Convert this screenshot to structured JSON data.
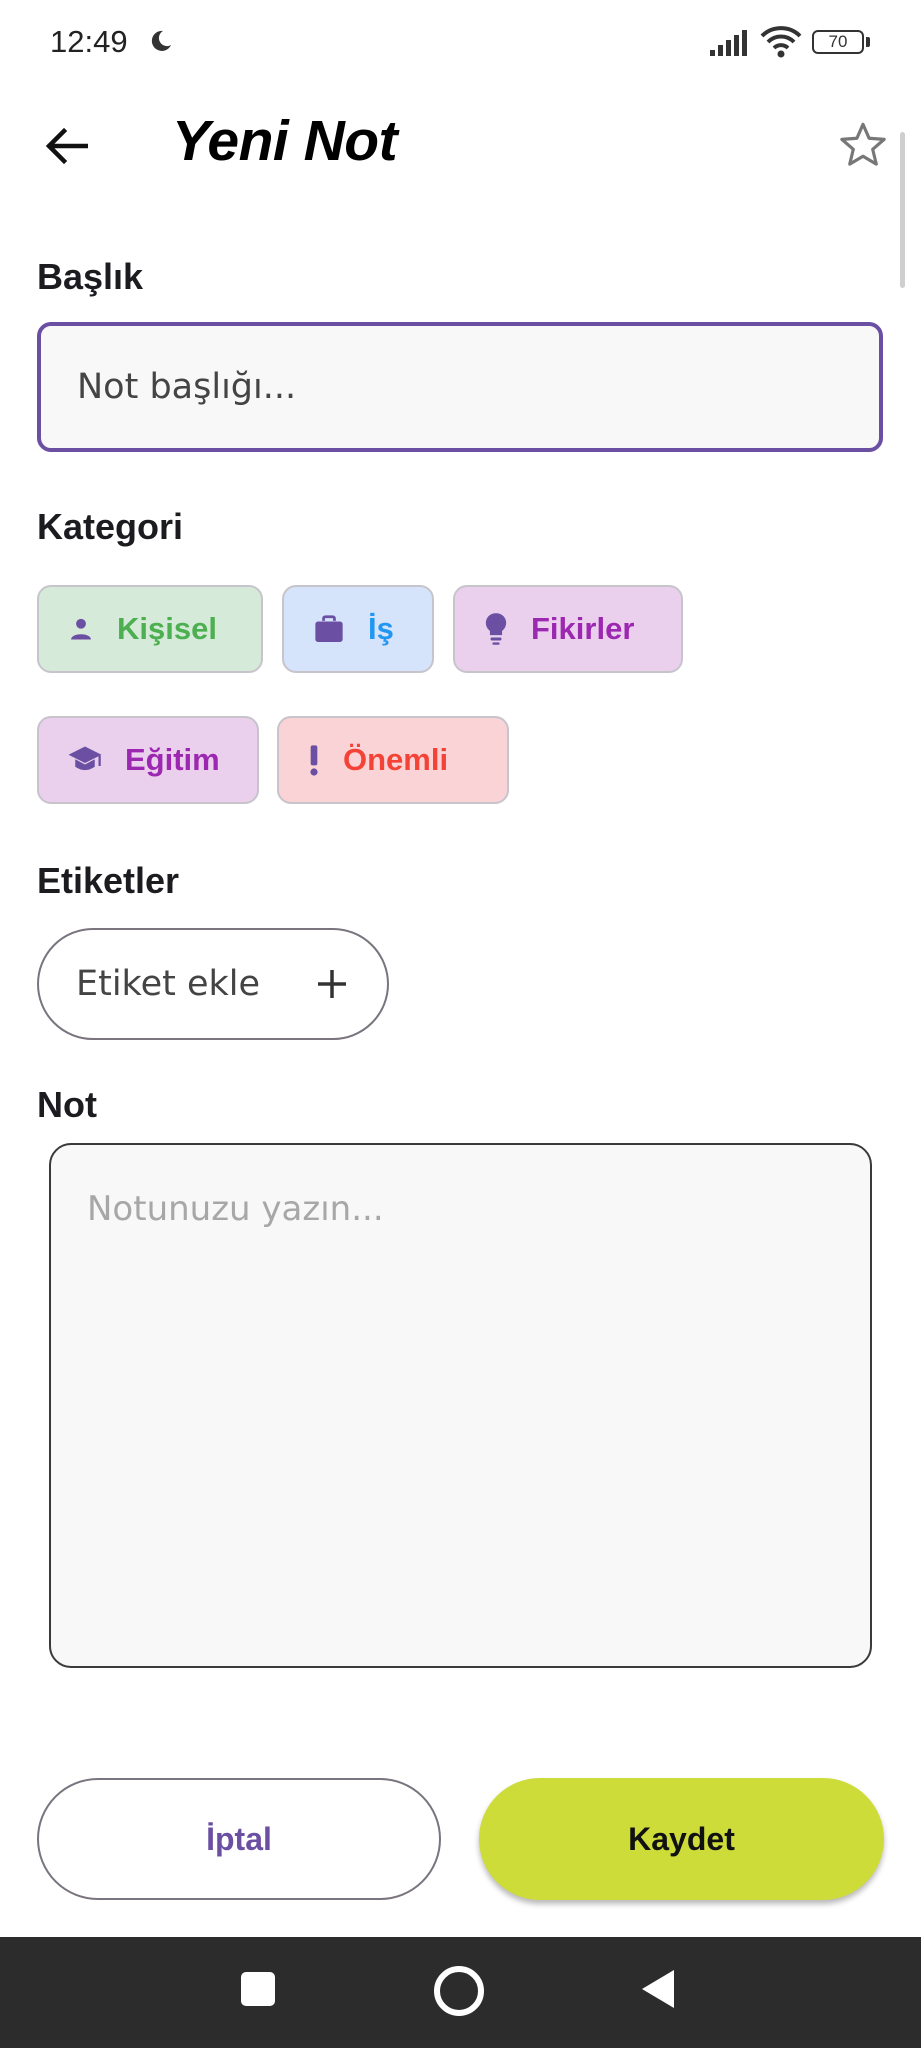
{
  "status_bar": {
    "time": "12:49",
    "battery": "70"
  },
  "app_bar": {
    "title": "Yeni Not"
  },
  "colors": {
    "accent": "#6a4fa3",
    "save": "#cddc39"
  },
  "form": {
    "title_label": "Başlık",
    "title_placeholder": "Not başlığı...",
    "category_label": "Kategori",
    "categories": [
      {
        "label": "Kişisel",
        "icon": "person-icon",
        "bg": "#d6ead9",
        "color": "#4caf50"
      },
      {
        "label": "İş",
        "icon": "briefcase-icon",
        "bg": "#d5e3fb",
        "color": "#2196f3"
      },
      {
        "label": "Fikirler",
        "icon": "lightbulb-icon",
        "bg": "#ebd0ee",
        "color": "#9c27b0"
      },
      {
        "label": "Eğitim",
        "icon": "graduation-cap-icon",
        "bg": "#ebd0ee",
        "color": "#9c27b0"
      },
      {
        "label": "Önemli",
        "icon": "exclamation-icon",
        "bg": "#fad3d6",
        "color": "#f44336"
      }
    ],
    "tags_label": "Etiketler",
    "add_tag_label": "Etiket ekle",
    "note_label": "Not",
    "note_placeholder": "Notunuzu yazın..."
  },
  "actions": {
    "cancel": "İptal",
    "save": "Kaydet"
  }
}
